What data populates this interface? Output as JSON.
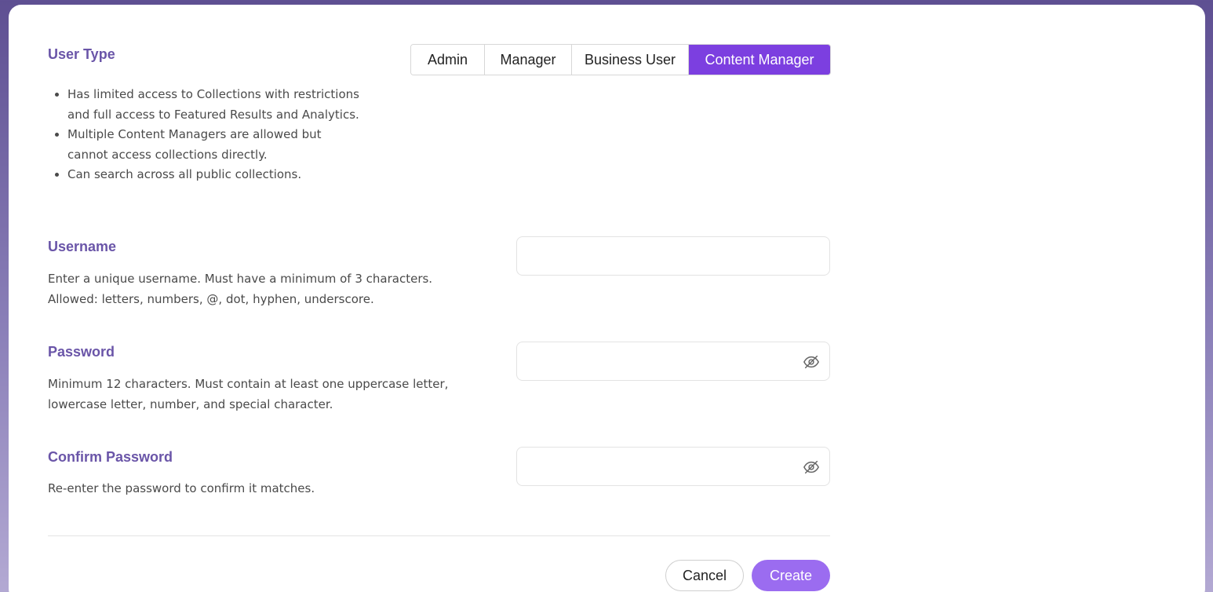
{
  "user_type": {
    "title": "User Type",
    "bullets": [
      "Has limited access to Collections with restrictions and full access to Featured Results and Analytics.",
      "Multiple Content Managers are allowed but cannot access collections directly.",
      "Can search across all public collections."
    ],
    "options": [
      "Admin",
      "Manager",
      "Business User",
      "Content Manager"
    ],
    "selected": "Content Manager"
  },
  "username": {
    "title": "Username",
    "description_line1": "Enter a unique username. Must have a minimum of 3 characters.",
    "description_line2": "Allowed: letters, numbers, @, dot, hyphen, underscore.",
    "value": ""
  },
  "password": {
    "title": "Password",
    "description_line1": "Minimum 12 characters. Must contain at least one uppercase letter,",
    "description_line2": "lowercase letter, number, and special character.",
    "value": "",
    "toggle_icon": "eye-off-icon"
  },
  "confirm_password": {
    "title": "Confirm Password",
    "description": "Re-enter the password to confirm it matches.",
    "value": "",
    "toggle_icon": "eye-off-icon"
  },
  "actions": {
    "cancel_label": "Cancel",
    "create_label": "Create"
  },
  "colors": {
    "accent": "#7c3fe0",
    "title": "#6a55a8",
    "create_button": "#9b6cf0"
  }
}
